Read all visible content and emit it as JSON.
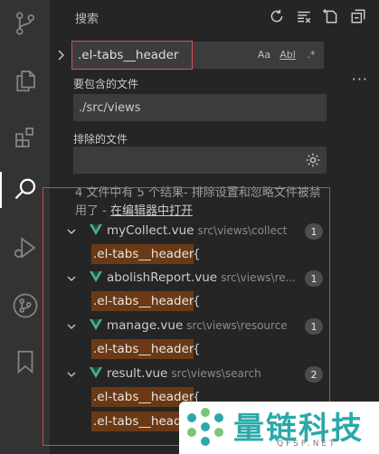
{
  "activity_bar": {
    "items": [
      {
        "name": "source-control-icon"
      },
      {
        "name": "explorer-files-icon"
      },
      {
        "name": "extensions-icon"
      },
      {
        "name": "search-icon"
      },
      {
        "name": "run-debug-icon"
      },
      {
        "name": "git-graph-icon"
      },
      {
        "name": "bookmark-icon"
      }
    ],
    "active": "search-icon"
  },
  "search_panel": {
    "title": "搜索",
    "actions": [
      "refresh-icon",
      "clear-results-icon",
      "new-search-editor-icon",
      "collapse-all-icon"
    ],
    "query": ".el-tabs__header",
    "options": {
      "match_case": "Aa",
      "whole_word": "Abl",
      "regex": ".*"
    },
    "more": "···",
    "include_label": "要包含的文件",
    "include_value": "./src/views",
    "exclude_label": "排除的文件",
    "exclude_value": ""
  },
  "results": {
    "summary_prefix": "4 文件中有 5 个结果- 排除设置和忽略文件被禁用了 - ",
    "summary_link": "在编辑器中打开",
    "files": [
      {
        "name": "myCollect.vue",
        "path": "src\\views\\collect",
        "count": "1",
        "matches": [
          {
            "highlight": ".el-tabs__header",
            "rest": "{"
          }
        ]
      },
      {
        "name": "abolishReport.vue",
        "path": "src\\views\\re...",
        "count": "1",
        "matches": [
          {
            "highlight": ".el-tabs__header",
            "rest": "{"
          }
        ]
      },
      {
        "name": "manage.vue",
        "path": "src\\views\\resource",
        "count": "1",
        "matches": [
          {
            "highlight": ".el-tabs__header",
            "rest": "{"
          }
        ]
      },
      {
        "name": "result.vue",
        "path": "src\\views\\search",
        "count": "2",
        "matches": [
          {
            "highlight": ".el-tabs__header",
            "rest": "{"
          },
          {
            "highlight": ".el-tabs__heade",
            "rest": ""
          }
        ]
      }
    ]
  },
  "watermark": {
    "text": "量链科技",
    "sub": "QFSP.NET"
  },
  "colors": {
    "accent_vue": "#41b883",
    "match_bg": "#6b3a15",
    "outline_red": "#e05050"
  }
}
